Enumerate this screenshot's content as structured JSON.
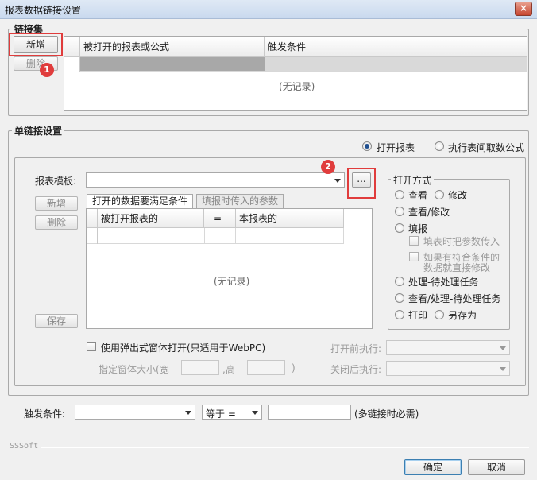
{
  "window": {
    "title": "报表数据链接设置",
    "close": "×"
  },
  "link_set": {
    "label": "链接集",
    "add_button": "新增",
    "delete_button": "删除",
    "columns": [
      "被打开的报表或公式",
      "触发条件"
    ],
    "empty_text": "(无记录)"
  },
  "single_link": {
    "label": "单链接设置",
    "mode_options": [
      "打开报表",
      "执行表间取数公式"
    ],
    "report_template_label": "报表模板:",
    "browse_button": "...",
    "tabs": [
      "打开的数据要满足条件",
      "填报时传入的参数"
    ],
    "side_buttons": {
      "add": "新增",
      "delete": "删除",
      "save": "保存"
    },
    "condition_columns": [
      "被打开报表的",
      "=",
      "本报表的"
    ],
    "empty_text": "(无记录)",
    "popup_checkbox": "使用弹出式窗体打开(只适用于WebPC)",
    "window_size_label": "指定窗体大小(宽",
    "height_sep": ",高",
    "close_paren": ")",
    "before_open_label": "打开前执行:",
    "after_close_label": "关闭后执行:",
    "open_mode": {
      "label": "打开方式",
      "options": {
        "view": "查看",
        "modify": "修改",
        "view_modify": "查看/修改",
        "fill": "填报",
        "fill_param": "填表时把参数传入",
        "fill_direct_1": "如果有符合条件的",
        "fill_direct_2": "数据就直接修改",
        "pending": "处理-待处理任务",
        "view_pending": "查看/处理-待处理任务",
        "print": "打印",
        "save_as": "另存为"
      }
    }
  },
  "trigger": {
    "label": "触发条件:",
    "operator": "等于 =",
    "note": "(多链接时必需)"
  },
  "footer": {
    "brand": "SSSoft",
    "ok": "确定",
    "cancel": "取消"
  },
  "annotations": {
    "badge1": "1",
    "badge2": "2"
  }
}
